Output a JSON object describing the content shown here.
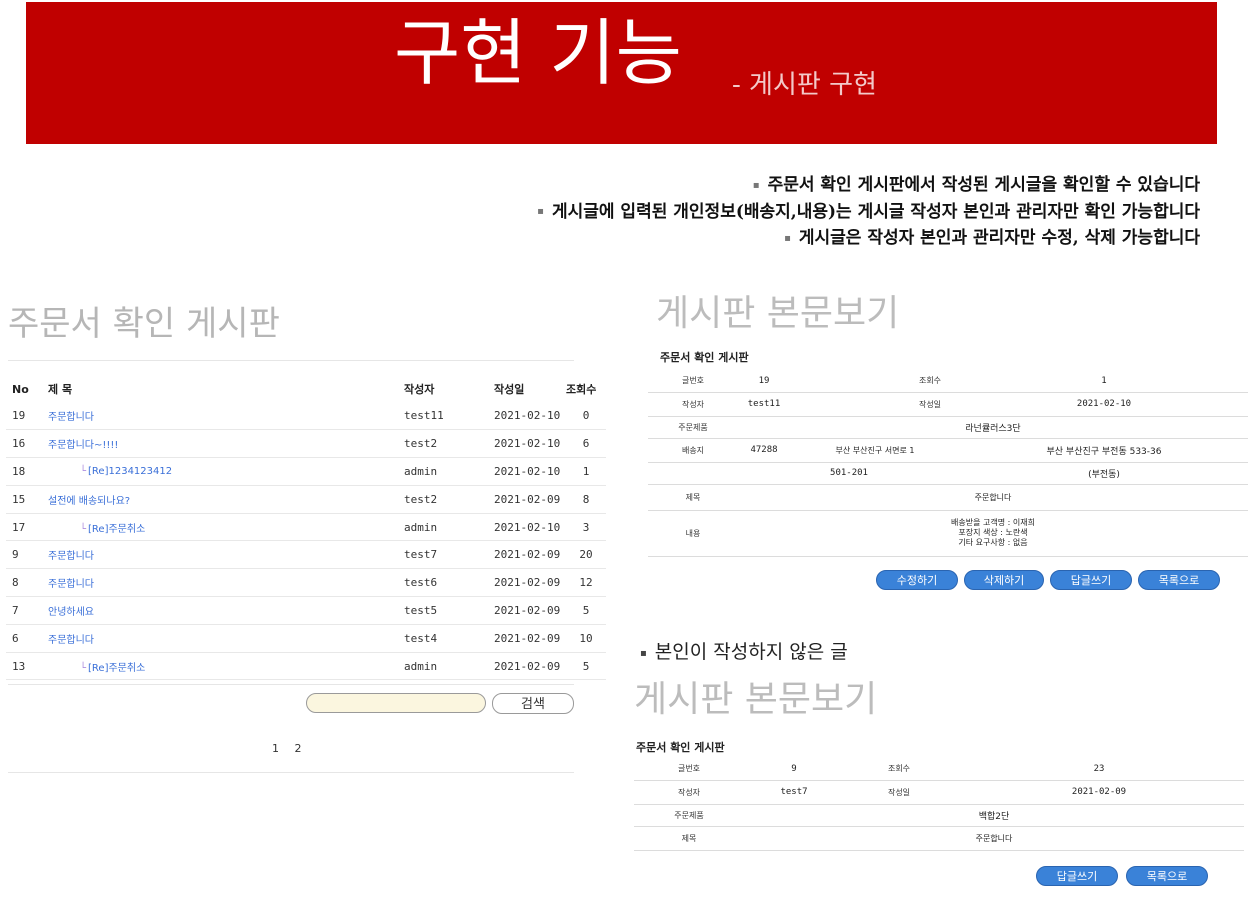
{
  "banner": {
    "title": "구현 기능",
    "subtitle": "- 게시판 구현"
  },
  "bullets": [
    "주문서 확인 게시판에서 작성된 게시글을 확인할 수 있습니다",
    "게시글에 입력된 개인정보(배송지,내용)는 게시글 작성자 본인과 관리자만 확인 가능합니다",
    "게시글은 작성자 본인과 관리자만 수정, 삭제 가능합니다"
  ],
  "bullet_marker": "▪",
  "list_board": {
    "title": "주문서 확인 게시판",
    "headers": {
      "no": "No",
      "subject": "제 목",
      "writer": "작성자",
      "date": "작성일",
      "views": "조회수"
    },
    "rows": [
      {
        "no": "19",
        "subject": "주문합니다",
        "writer": "test11",
        "date": "2021-02-10",
        "views": "0",
        "reply": false
      },
      {
        "no": "16",
        "subject": "주문합니다~!!!!",
        "writer": "test2",
        "date": "2021-02-10",
        "views": "6",
        "reply": false
      },
      {
        "no": "18",
        "subject": "[Re]1234123412",
        "writer": "admin",
        "date": "2021-02-10",
        "views": "1",
        "reply": true
      },
      {
        "no": "15",
        "subject": "설전에 배송되나요?",
        "writer": "test2",
        "date": "2021-02-09",
        "views": "8",
        "reply": false
      },
      {
        "no": "17",
        "subject": "[Re]주문취소",
        "writer": "admin",
        "date": "2021-02-10",
        "views": "3",
        "reply": true
      },
      {
        "no": "9",
        "subject": "주문합니다",
        "writer": "test7",
        "date": "2021-02-09",
        "views": "20",
        "reply": false
      },
      {
        "no": "8",
        "subject": "주문합니다",
        "writer": "test6",
        "date": "2021-02-09",
        "views": "12",
        "reply": false
      },
      {
        "no": "7",
        "subject": "안녕하세요",
        "writer": "test5",
        "date": "2021-02-09",
        "views": "5",
        "reply": false
      },
      {
        "no": "6",
        "subject": "주문합니다",
        "writer": "test4",
        "date": "2021-02-09",
        "views": "10",
        "reply": false
      },
      {
        "no": "13",
        "subject": "[Re]주문취소",
        "writer": "admin",
        "date": "2021-02-09",
        "views": "5",
        "reply": true
      }
    ],
    "reply_mark": "└",
    "search_value": "",
    "search_label": "검색",
    "pages": "1 2"
  },
  "view1": {
    "title": "게시판 본문보기",
    "board_name": "주문서 확인 게시판",
    "labels": {
      "no": "글번호",
      "views": "조회수",
      "writer": "작성자",
      "date": "작성일",
      "product": "주문제품",
      "address": "배송지",
      "subject": "제목",
      "content": "내용"
    },
    "no": "19",
    "views": "1",
    "writer": "test11",
    "date": "2021-02-10",
    "product": "라넌큘러스3단",
    "zip": "47288",
    "addr1": "부산 부산진구 서면로 1",
    "addr2": "부산 부산진구 부전동 533-36",
    "addr3": "501-201",
    "addr4": "(부전동)",
    "subject": "주문합니다",
    "content": [
      "배송받을 고객명 : 이재희",
      "포장지 색상 : 노란색",
      "기타 요구사항 : 없음"
    ],
    "buttons": [
      "수정하기",
      "삭제하기",
      "답글쓰기",
      "목록으로"
    ]
  },
  "note": "본인이 작성하지 않은 글",
  "view2": {
    "title": "게시판 본문보기",
    "board_name": "주문서 확인 게시판",
    "labels": {
      "no": "글번호",
      "views": "조회수",
      "writer": "작성자",
      "date": "작성일",
      "product": "주문제품",
      "subject": "제목"
    },
    "no": "9",
    "views": "23",
    "writer": "test7",
    "date": "2021-02-09",
    "product": "백합2단",
    "subject": "주문합니다",
    "buttons": [
      "답글쓰기",
      "목록으로"
    ]
  },
  "colors": {
    "banner": "#c00000",
    "button": "#3a82d8",
    "link": "#3a6fd8"
  }
}
